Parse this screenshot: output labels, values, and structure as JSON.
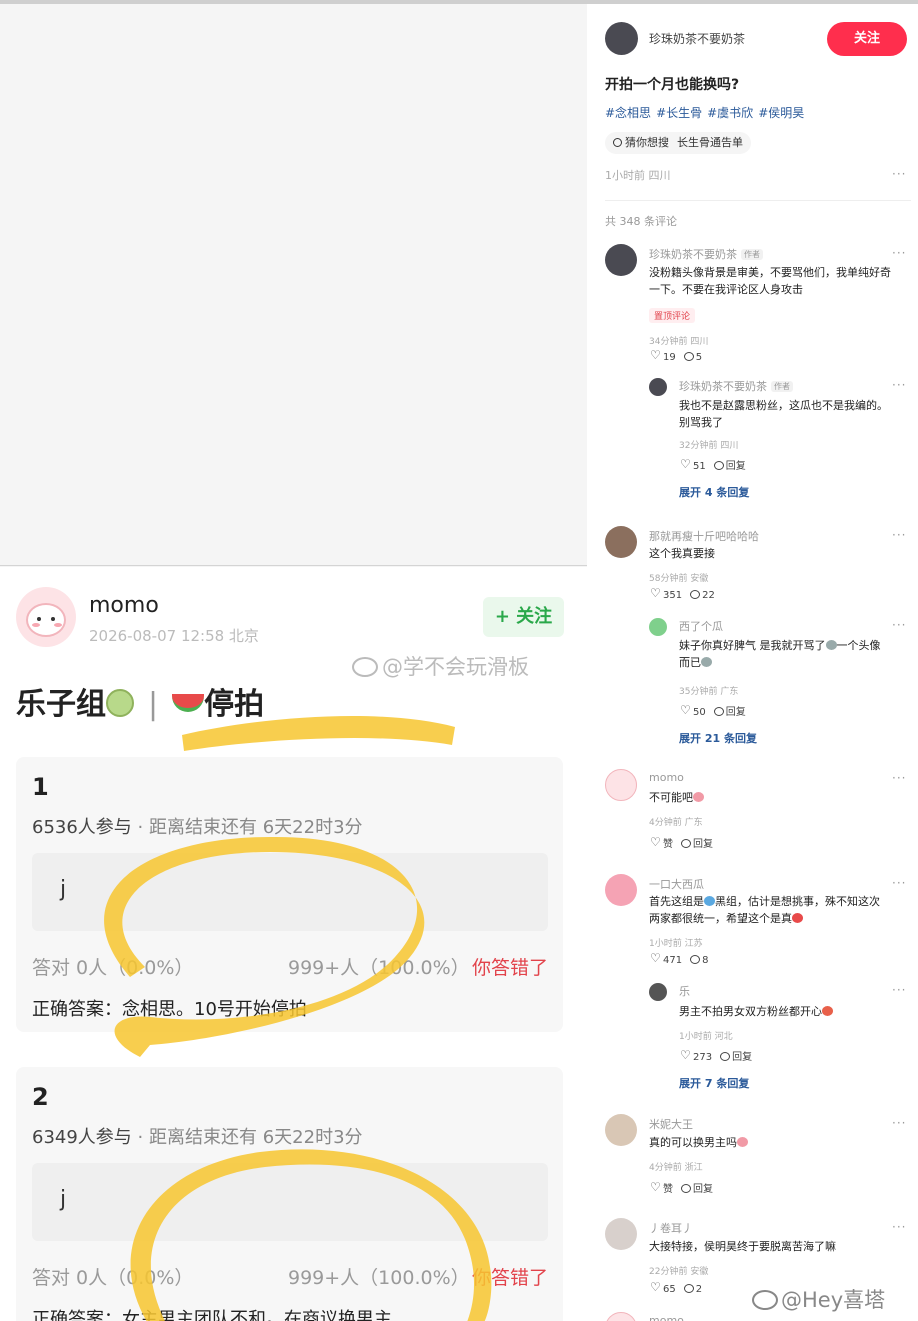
{
  "left_post": {
    "username": "momo",
    "timestamp": "2026-08-07 12:58 北京",
    "follow_label": "+ 关注",
    "watermark": "@学不会玩滑板",
    "title_a": "乐子组",
    "title_sep": "|",
    "title_b": "停拍",
    "polls": [
      {
        "number": "1",
        "participants": "6536人参与",
        "deadline": "· 距离结束还有 6天22时3分",
        "answer": "j",
        "correct_stat": "答对  0人（0.0%）",
        "total_stat": "999+人（100.0%）",
        "result": "你答错了",
        "correct_answer": "正确答案：念相思。10号开始停拍"
      },
      {
        "number": "2",
        "participants": "6349人参与",
        "deadline": "· 距离结束还有 6天22时3分",
        "answer": "j",
        "correct_stat": "答对  0人（0.0%）",
        "total_stat": "999+人（100.0%）",
        "result": "你答错了",
        "correct_answer": "正确答案：女主男主团队不和。在商议换男主"
      }
    ]
  },
  "right_post": {
    "author": "珍珠奶茶不要奶茶",
    "follow_label": "关注",
    "title": "开拍一个月也能换吗?",
    "tags": [
      "#念相思",
      "#长生骨",
      "#虞书欣",
      "#侯明昊"
    ],
    "search_label": "猜你想搜",
    "search_query": "长生骨通告单",
    "time_location": "1小时前 四川",
    "more_icon": "···",
    "comment_count": "共 348 条评论",
    "author_tag": "作者",
    "pin_label": "置顶评论",
    "reply_label": "回复",
    "like_label": "赞",
    "comments": [
      {
        "name": "珍珠奶茶不要奶茶",
        "text_line1": "没粉籍头像背景是审美，不要骂他们，我单纯好奇",
        "text_line2": "一下。不要在我评论区人身攻击",
        "time": "34分钟前 四川",
        "likes": "19",
        "replies": "5"
      },
      {
        "name": "珍珠奶茶不要奶茶",
        "text_line1": "我也不是赵露思粉丝，这瓜也不是我编的。",
        "text_line2": "别骂我了",
        "time": "32分钟前 四川",
        "likes": "51",
        "expand": "展开 4 条回复"
      },
      {
        "name": "那就再瘦十斤吧哈哈哈",
        "text_line1": "这个我真要接",
        "time": "58分钟前 安徽",
        "likes": "351",
        "replies": "22"
      },
      {
        "name": "西了个瓜",
        "text_line1": "妹子你真好脾气 是我就开骂了",
        "text_line1b": "一个头像",
        "text_line2": "而已",
        "time": "35分钟前 广东",
        "likes": "50",
        "expand": "展开 21 条回复"
      },
      {
        "name": "momo",
        "text_line1": "不可能吧",
        "time": "4分钟前 广东"
      },
      {
        "name": "一口大西瓜",
        "text_line1a": "首先这组是",
        "text_line1b": "黑组，估计是想挑事，殊不知这次",
        "text_line2": "两家都很统一，希望这个是真",
        "time": "1小时前 江苏",
        "likes": "471",
        "replies": "8"
      },
      {
        "name": "乐",
        "text_line1": "男主不拍男女双方粉丝都开心",
        "time": "1小时前 河北",
        "likes": "273",
        "expand": "展开 7 条回复"
      },
      {
        "name": "米妮大王",
        "text_line1": "真的可以换男主吗",
        "time": "4分钟前 浙江"
      },
      {
        "name": "丿卷耳丿",
        "text_line1": "大接特接，侯明昊终于要脱离苦海了嘛",
        "time": "22分钟前 安徽",
        "likes": "65",
        "replies": "2"
      },
      {
        "name": "momo"
      }
    ],
    "watermark": "@Hey喜塔"
  },
  "colors": {
    "follow_red": "#ff2e4d",
    "follow_green": "#2aa84a",
    "wrong_red": "#e2434b",
    "link_blue": "#2b5a9a",
    "highlighter": "#f7c62f"
  }
}
